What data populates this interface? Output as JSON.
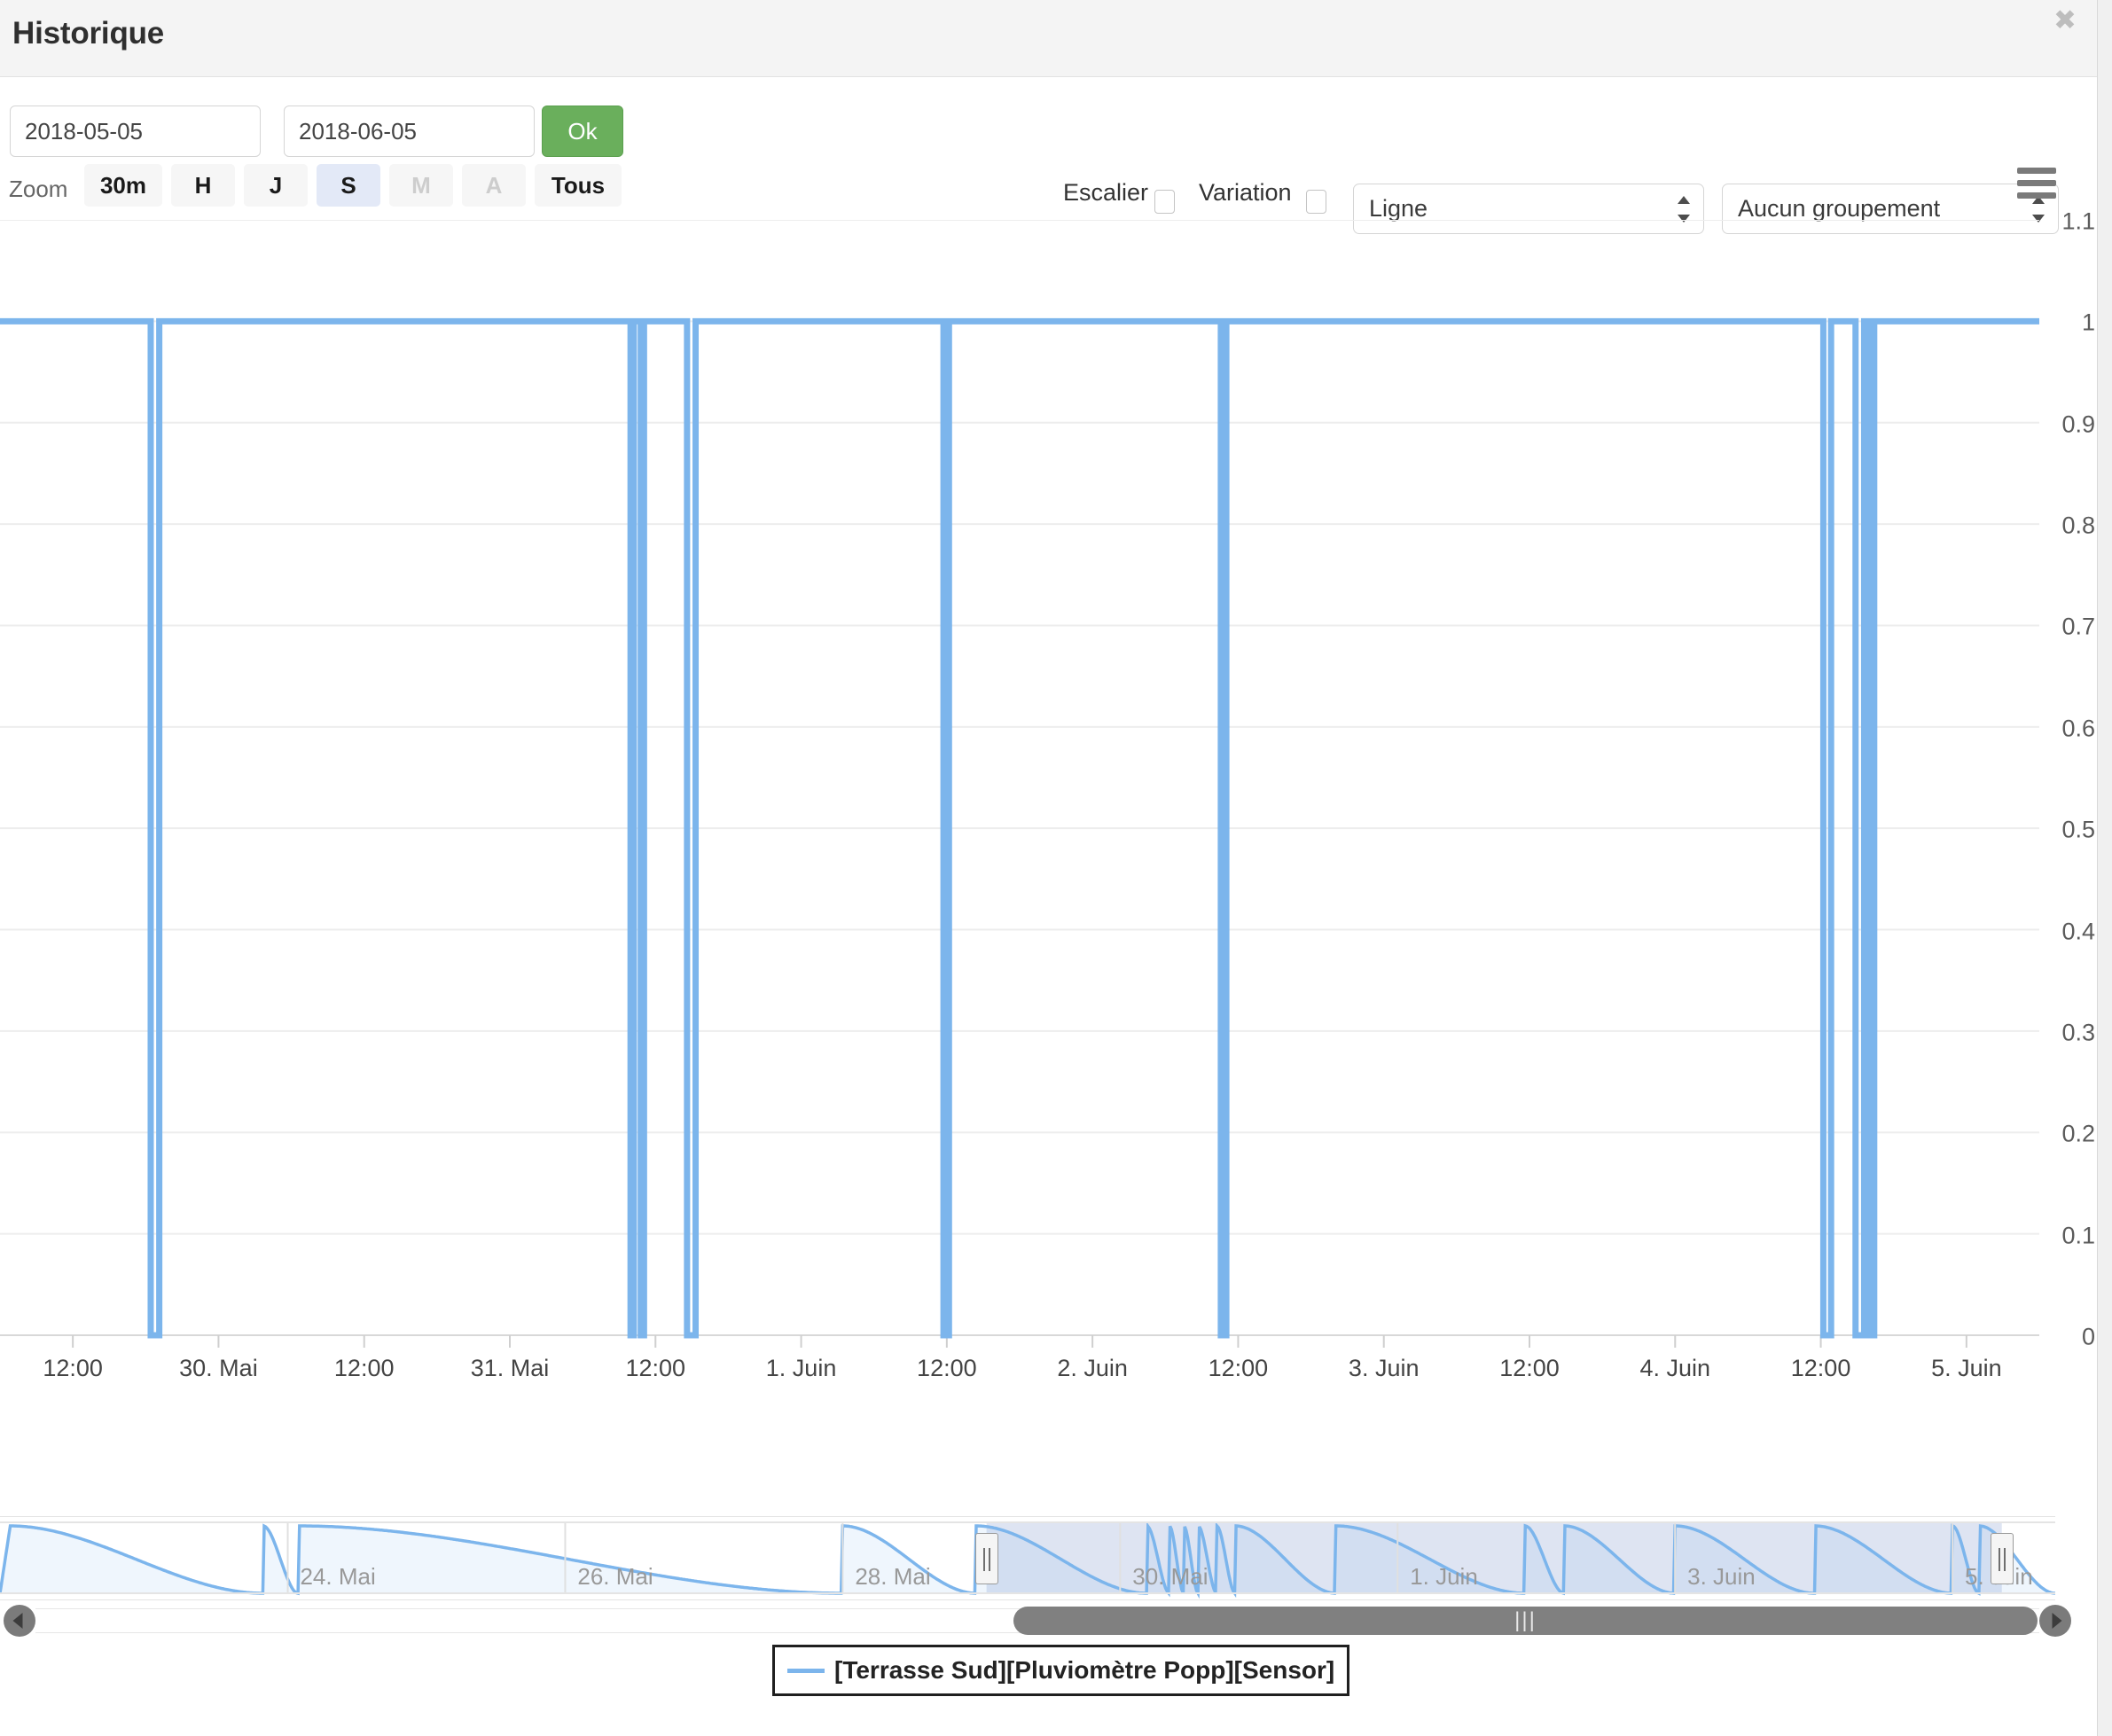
{
  "window": {
    "title": "Historique",
    "close_icon": "close-icon"
  },
  "toolbar": {
    "date_start": "2018-05-05",
    "date_end": "2018-06-05",
    "date_placeholder": "YYYY-MM-DD",
    "ok_label": "Ok",
    "escalier_label": "Escalier",
    "escalier_checked": false,
    "variation_label": "Variation",
    "variation_checked": false,
    "chart_type": "Ligne",
    "grouping": "Aucun groupement",
    "menu_icon": "hamburger-menu-icon"
  },
  "zoom_bar": {
    "label": "Zoom",
    "buttons": [
      {
        "label": "30m",
        "state": "normal"
      },
      {
        "label": "H",
        "state": "normal"
      },
      {
        "label": "J",
        "state": "normal"
      },
      {
        "label": "S",
        "state": "selected"
      },
      {
        "label": "M",
        "state": "disabled"
      },
      {
        "label": "A",
        "state": "disabled"
      },
      {
        "label": "Tous",
        "state": "normal"
      }
    ]
  },
  "chart_data": {
    "type": "line",
    "title": "",
    "subtitle": "",
    "xlabel": "",
    "ylabel": "",
    "ylim": [
      0,
      1.1
    ],
    "grid": true,
    "legend_position": "bottom",
    "series_color": "#7cb5ec",
    "y_ticks": [
      "1.1",
      "1",
      "0.9",
      "0.8",
      "0.7",
      "0.6",
      "0.5",
      "0.4",
      "0.3",
      "0.2",
      "0.1",
      "0"
    ],
    "y_tick_values": [
      1.1,
      1,
      0.9,
      0.8,
      0.7,
      0.6,
      0.5,
      0.4,
      0.3,
      0.2,
      0.1,
      0
    ],
    "x_ticks": [
      "12:00",
      "30. Mai",
      "12:00",
      "31. Mai",
      "12:00",
      "1. Juin",
      "12:00",
      "2. Juin",
      "12:00",
      "3. Juin",
      "12:00",
      "4. Juin",
      "12:00",
      "5. Juin"
    ],
    "x_range": [
      "2018-05-29 06:00",
      "2018-06-05 06:00"
    ],
    "series": [
      {
        "name": "[Terrasse Sud][Pluviomètre Popp][Sensor]",
        "color": "#7cb5ec",
        "description": "Baseline held at value 1 with brief vertical drops to 0 (sensor reset spikes).",
        "baseline": 1,
        "spike_value": 0,
        "spikes": [
          {
            "x_pct": 7.6,
            "width_pct": 0.42,
            "label": "30. Mai ~00:00"
          },
          {
            "x_pct": 31.0,
            "width_pct": 0.16,
            "label": "31. Mai ~14:00"
          },
          {
            "x_pct": 31.5,
            "width_pct": 0.16,
            "label": "31. Mai ~14:30"
          },
          {
            "x_pct": 33.9,
            "width_pct": 0.42,
            "label": "31. Mai ~20:00"
          },
          {
            "x_pct": 46.4,
            "width_pct": 0.27,
            "label": "1. Juin ~17:00"
          },
          {
            "x_pct": 60.0,
            "width_pct": 0.27,
            "label": "2. Juin ~16:00"
          },
          {
            "x_pct": 89.6,
            "width_pct": 0.38,
            "label": "4. Juin ~18:00"
          },
          {
            "x_pct": 91.2,
            "width_pct": 0.42,
            "label": "4. Juin ~22:00"
          },
          {
            "x_pct": 91.8,
            "width_pct": 0.21,
            "label": "5. Juin ~00:00"
          }
        ]
      }
    ]
  },
  "navigator": {
    "labels": [
      "24. Mai",
      "26. Mai",
      "28. Mai",
      "30. Mai",
      "1. Juin",
      "3. Juin",
      "5. Juin"
    ],
    "selected_from_pct": 48.0,
    "selected_to_pct": 97.4,
    "series_color": "#7cb5ec",
    "left_handle_icon": "drag-handle-icon",
    "right_handle_icon": "drag-handle-icon"
  },
  "scrollbar": {
    "left_arrow_icon": "arrow-left-icon",
    "right_arrow_icon": "arrow-right-icon",
    "grip_glyph": "|||"
  },
  "legend": {
    "items": [
      {
        "label": "[Terrasse Sud][Pluviomètre Popp][Sensor]",
        "color": "#7cb5ec"
      }
    ]
  }
}
